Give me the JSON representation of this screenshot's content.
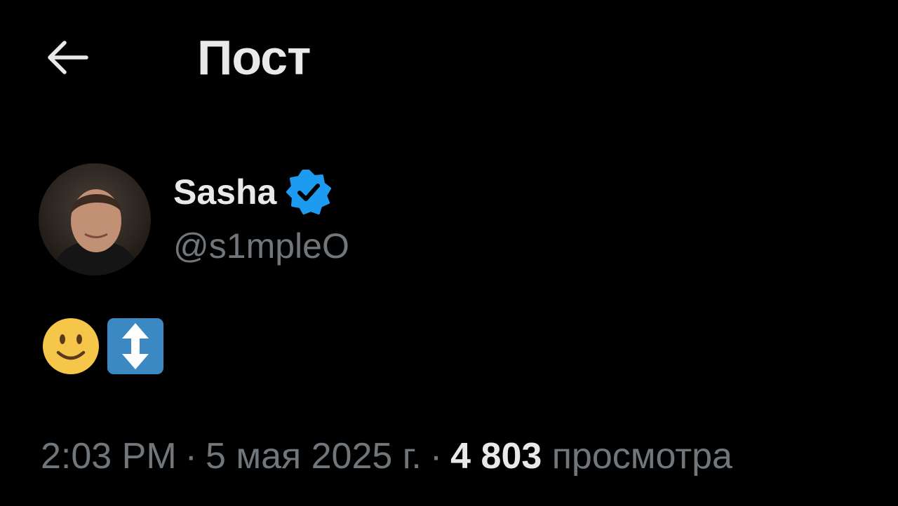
{
  "header": {
    "back_icon": "arrow-left-icon",
    "title": "Пост"
  },
  "author": {
    "display_name": "Sasha",
    "verified_icon": "verified-badge-icon",
    "verified_color": "#1d9bf0",
    "handle": "@s1mpleO"
  },
  "post": {
    "content_icons": [
      "slightly-smiling-face-emoji",
      "up-down-arrow-emoji"
    ]
  },
  "meta": {
    "time": "2:03 PM",
    "separator": "·",
    "date": "5 мая 2025 г.",
    "views_count": "4 803",
    "views_label": "просмотра"
  },
  "colors": {
    "background": "#000000",
    "primary_text": "#e7e9ea",
    "secondary_text": "#71767b"
  }
}
